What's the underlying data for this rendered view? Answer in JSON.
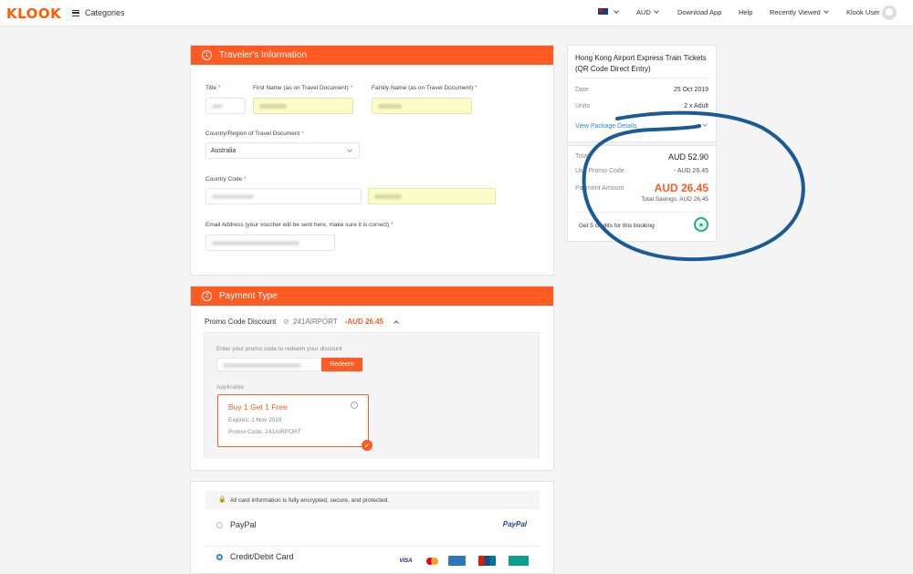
{
  "header": {
    "logo": "KLOOK",
    "categories": "Categories",
    "currency": "AUD",
    "download_app": "Download App",
    "help": "Help",
    "recently_viewed": "Recently Viewed",
    "user": "Klook User"
  },
  "traveler": {
    "number": "1",
    "title": "Traveler's Information",
    "title_label": "Title",
    "first_name_label": "First Name (as on Travel Document)",
    "family_name_label": "Family Name (as on Travel Document)",
    "country_label": "Country/Region of Travel Document",
    "country_value": "Australia",
    "country_code_label": "Country Code",
    "email_label": "Email Address (your voucher will be sent here, make sure it is correct)",
    "required_mark": "*"
  },
  "payment": {
    "number": "2",
    "title": "Payment Type",
    "promo_label": "Promo Code Discount",
    "promo_code": "241AIRPORT",
    "promo_amount": "-AUD 26.45",
    "promo_hint": "Enter your promo code to redeem your discount",
    "redeem": "Redeem",
    "applicable": "Applicable",
    "coupon_title": "Buy 1 Get 1 Free",
    "coupon_expires": "Expires: 1 Nov 2019",
    "coupon_code": "Promo Code: 241AIRPORT",
    "secure_note": "All card information is fully encrypted, secure, and protected.",
    "paypal_label": "PayPal",
    "paypal_logo": "PayPal",
    "card_label": "Credit/Debit Card",
    "visa": "VISA"
  },
  "summary": {
    "product": "Hong Kong Airport Express Train Tickets (QR Code Direct Entry)",
    "date_label": "Date",
    "date_value": "25 Oct 2019",
    "units_label": "Units",
    "units_value": "2 x Adult",
    "view_details": "View Package Details",
    "total_label": "Total",
    "total_value": "AUD 52.90",
    "promo_label": "Use Promo Code",
    "promo_value": "- AUD 26.45",
    "payment_label": "Payment Amount",
    "payment_value": "AUD 26.45",
    "savings": "Total Savings: AUD 26.45",
    "credits": "Get 5 credits for this booking"
  },
  "colors": {
    "accent": "#ff5b22",
    "link": "#2b8ae0",
    "annotation": "#1a5a96"
  }
}
